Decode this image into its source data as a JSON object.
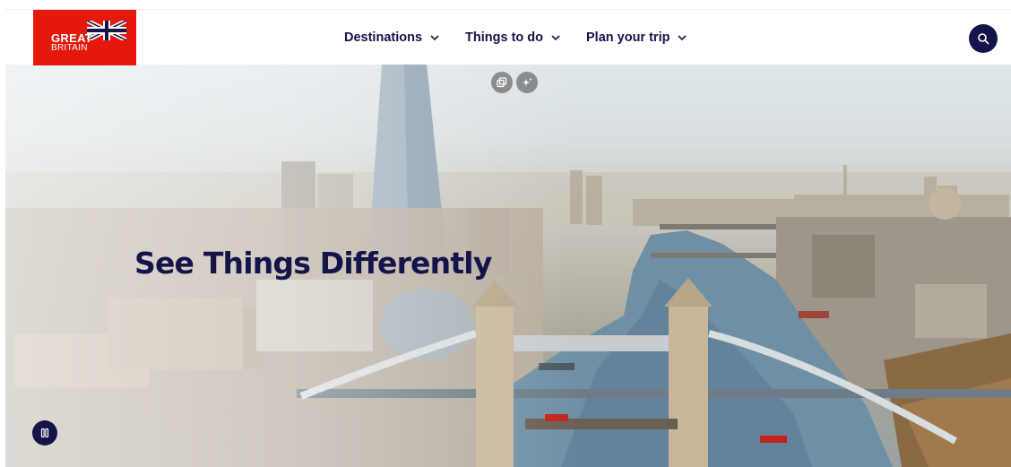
{
  "logo": {
    "line1": "GREAT",
    "line2": "BRITAIN",
    "flag_icon": "union-jack-icon"
  },
  "nav": {
    "items": [
      {
        "label": "Destinations"
      },
      {
        "label": "Things to do"
      },
      {
        "label": "Plan your trip"
      }
    ]
  },
  "search": {
    "icon": "search-icon"
  },
  "hero": {
    "title": "See Things Differently",
    "controls": [
      "copy-icon",
      "sparkle-icon",
      "pause-icon"
    ]
  },
  "colors": {
    "brand_navy": "#15144a",
    "logo_red": "#e4190b"
  }
}
